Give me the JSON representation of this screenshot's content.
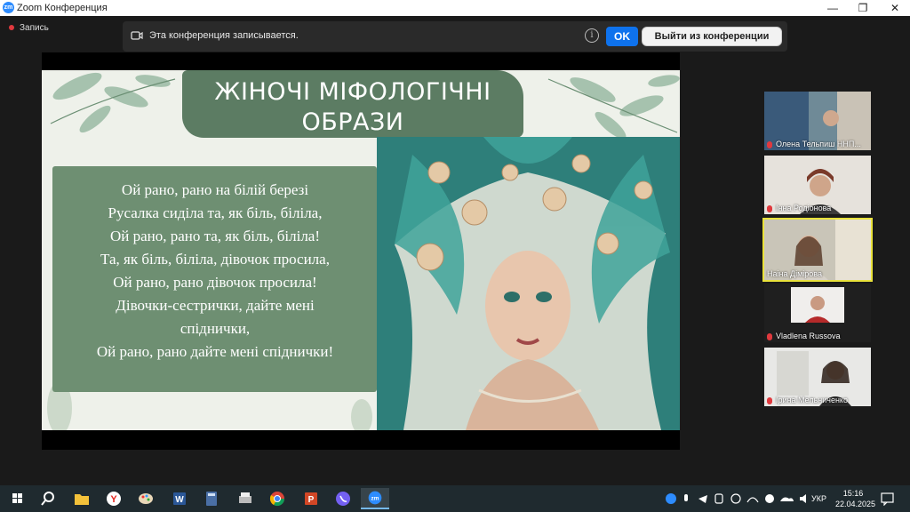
{
  "window": {
    "title": "Zoom Конференция",
    "logo_text": "zm",
    "minimize": "—",
    "maximize": "❐",
    "close": "✕"
  },
  "recording": {
    "label": "Запись"
  },
  "banner": {
    "message": "Эта конференция записывается.",
    "info": "i",
    "ok_label": "OK",
    "leave_label": "Выйти из конференции"
  },
  "slide": {
    "title": "ЖІНОЧІ МІФОЛОГІЧНІ ОБРАЗИ",
    "poem": [
      "Ой рано, рано на білій березі",
      "Русалка сиділа та, як біль, біліла,",
      "Ой рано, рано та, як біль, біліла!",
      "Та, як біль, біліла, дівочок просила,",
      "Ой рано, рано дівочок просила!",
      "Дівочки-сестрички, дайте мені",
      "спіднички,",
      "Ой рано, рано дайте мені спіднички!"
    ]
  },
  "participants": [
    {
      "name": "Олена Тельпиш ННП...",
      "active": false
    },
    {
      "name": "Інна Родіонова",
      "active": false
    },
    {
      "name": "Наіна Дімірова",
      "active": true
    },
    {
      "name": "Vladlena Russova",
      "active": false
    },
    {
      "name": "Ірина Мельниченко",
      "active": false
    }
  ],
  "taskbar": {
    "apps": [
      "windows-start",
      "search",
      "file-explorer",
      "yandex-browser",
      "paint",
      "word",
      "calculator",
      "printer",
      "chrome",
      "powerpoint",
      "viber",
      "zoom"
    ],
    "tray_icons": [
      "zoom-tray",
      "microphone",
      "telegram",
      "shield",
      "viber-tray",
      "wifi",
      "yandex-tray",
      "onedrive",
      "volume"
    ],
    "language": "УКР",
    "time": "15:16",
    "date": "22.04.2025"
  },
  "colors": {
    "accent": "#0e72ed",
    "active_speaker": "#e9e23b",
    "slide_green": "#5c7c63",
    "record_red": "#e0393e"
  }
}
